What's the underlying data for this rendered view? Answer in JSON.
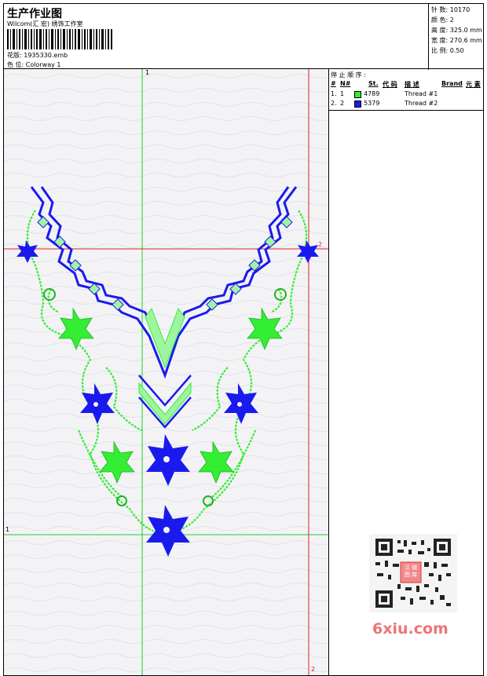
{
  "header": {
    "title": "生产作业图",
    "company": "Wilcom(汇 宏) 绣饰工作室",
    "design_file": "花版: 1935330.emb",
    "colorway": "色 位: Colorway 1"
  },
  "stats": {
    "stitches": "针 数: 10170",
    "colors": "颜 色: 2",
    "height": "高 度: 325.0 mm",
    "width": "宽 度: 270.6 mm",
    "scale": "比 例: 0.50"
  },
  "stop_sequence": {
    "title": "停 止 顺 序 :",
    "columns": [
      "#",
      "N#",
      "St.",
      "代 码",
      "描 述",
      "Brand",
      "元 素"
    ],
    "rows": [
      {
        "index": "1.",
        "needle": "1",
        "color_hex": "#33ee33",
        "code": "4789",
        "description": "Thread #1"
      },
      {
        "index": "2.",
        "needle": "2",
        "color_hex": "#1a1aee",
        "code": "5379",
        "description": "Thread #2"
      }
    ]
  },
  "guides": {
    "v1_label": "1",
    "h1_label": "1",
    "h2_label": "2",
    "v2_label": "2"
  },
  "colors": {
    "green_thread": "#33ee33",
    "blue_thread": "#1a1aee",
    "guide_green": "#22cc22",
    "guide_red": "#dd2222"
  },
  "watermark": {
    "text": "6xiu.com",
    "seal": "汉 微 图 库"
  }
}
